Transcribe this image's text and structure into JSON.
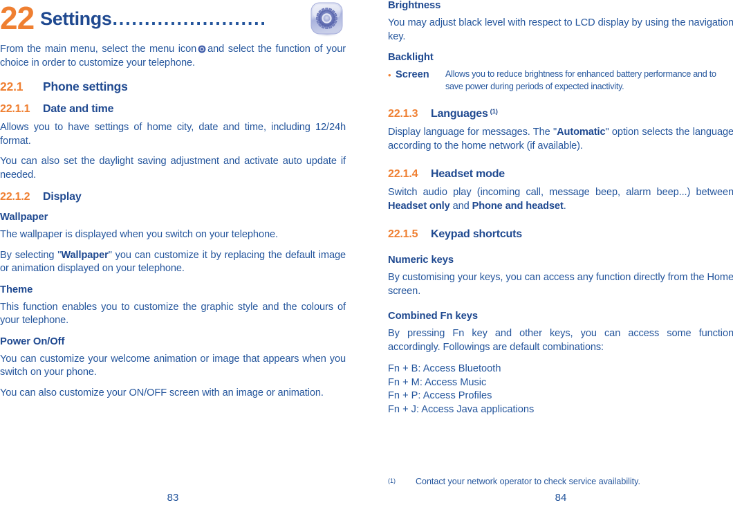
{
  "chapter": {
    "number": "22",
    "title": "Settings",
    "leader": "........................",
    "icon": "settings-gear-icon"
  },
  "colors": {
    "orange": "#ef7f31",
    "blue": "#24559c",
    "blue_dark": "#1f4990"
  },
  "left_page": {
    "intro_before_icon": "From the main menu, select the menu icon",
    "intro_after_icon": "and select the function of your choice in order to customize your telephone.",
    "section": {
      "num": "22.1",
      "label": "Phone settings"
    },
    "sub_date_time": {
      "num": "22.1.1",
      "label": "Date and time"
    },
    "date_time_p1": "Allows you to have settings of home city, date and time, including 12/24h format.",
    "date_time_p2": "You can also set the daylight saving adjustment and activate auto update if needed.",
    "sub_display": {
      "num": "22.1.2",
      "label": "Display"
    },
    "wallpaper_heading": "Wallpaper",
    "wallpaper_p1": "The wallpaper is displayed when you switch on your telephone.",
    "wallpaper_p2_a": "By selecting \"",
    "wallpaper_p2_bold": "Wallpaper",
    "wallpaper_p2_b": "\" you can customize it by replacing the default image or animation displayed on your telephone.",
    "theme_heading": "Theme",
    "theme_p1": "This function enables you to customize the graphic style and the colours of your telephone.",
    "power_heading": "Power On/Off",
    "power_p1": "You can customize your welcome animation or image that appears when you switch on your phone.",
    "power_p2": "You can also customize your ON/OFF screen with an image or animation.",
    "page_number": "83"
  },
  "right_page": {
    "brightness_heading": "Brightness",
    "brightness_p1": "You may adjust black level with respect to LCD display by using the navigation key.",
    "backlight_heading": "Backlight",
    "backlight_bullet": {
      "label": "Screen",
      "text": "Allows you to reduce brightness for enhanced battery performance and to save power during periods of expected inactivity."
    },
    "sub_languages": {
      "num": "22.1.3",
      "label": "Languages",
      "footnote_mark": "(1)"
    },
    "languages_p1_a": "Display language for messages. The \"",
    "languages_p1_bold": "Automatic",
    "languages_p1_b": "\" option selects the language according to the home network (if available).",
    "sub_headset": {
      "num": "22.1.4",
      "label": "Headset mode"
    },
    "headset_p1_a": "Switch audio play (incoming call, message beep, alarm beep...) between ",
    "headset_p1_bold1": "Headset only",
    "headset_p1_mid": " and ",
    "headset_p1_bold2": "Phone and headset",
    "headset_p1_end": ".",
    "sub_keypad": {
      "num": "22.1.5",
      "label": "Keypad shortcuts"
    },
    "numeric_heading": "Numeric keys",
    "numeric_p1": "By customising your keys, you can access any function directly from the Home screen.",
    "combined_heading": "Combined Fn keys",
    "combined_p1": "By pressing Fn key and other keys, you can access some function accordingly. Followings are default combinations:",
    "combo_list": "Fn + B: Access Bluetooth\nFn + M: Access Music\nFn + P: Access Profiles\nFn + J: Access Java applications",
    "footnote_mark": "(1)",
    "footnote_text": "Contact your network operator to check service availability.",
    "page_number": "84"
  }
}
